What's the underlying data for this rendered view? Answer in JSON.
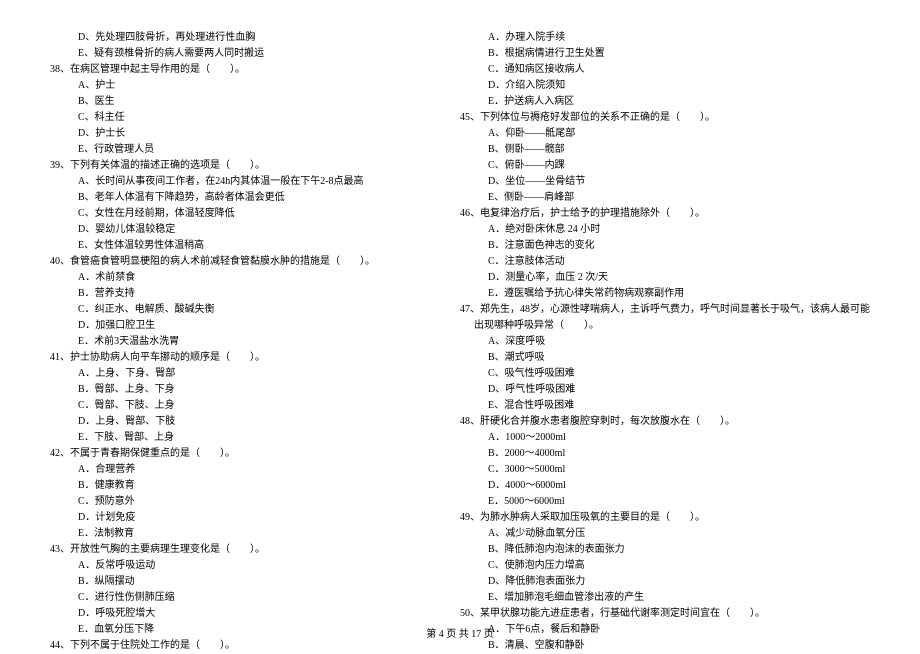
{
  "left": [
    {
      "cls": "opt",
      "t": "D、先处理四肢骨折，再处理进行性血胸"
    },
    {
      "cls": "opt",
      "t": "E、疑有颈椎骨折的病人需要两人同时搬运"
    },
    {
      "cls": "q",
      "t": "38、在病区管理中起主导作用的是（　　）。"
    },
    {
      "cls": "opt",
      "t": "A、护士"
    },
    {
      "cls": "opt",
      "t": "B、医生"
    },
    {
      "cls": "opt",
      "t": "C、科主任"
    },
    {
      "cls": "opt",
      "t": "D、护士长"
    },
    {
      "cls": "opt",
      "t": "E、行政管理人员"
    },
    {
      "cls": "q",
      "t": "39、下列有关体温的描述正确的选项是（　　）。"
    },
    {
      "cls": "opt",
      "t": "A、长时间从事夜间工作者，在24h内其体温一般在下午2-8点最高"
    },
    {
      "cls": "opt",
      "t": "B、老年人体温有下降趋势，高龄者体温会更低"
    },
    {
      "cls": "opt",
      "t": "C、女性在月经前期，体温轻度降低"
    },
    {
      "cls": "opt",
      "t": "D、婴幼儿体温较稳定"
    },
    {
      "cls": "opt",
      "t": "E、女性体温较男性体温稍高"
    },
    {
      "cls": "q",
      "t": "40、食管癌食管明显梗阻的病人术前减轻食管黏膜水肿的措施是（　　）。"
    },
    {
      "cls": "opt",
      "t": "A．术前禁食"
    },
    {
      "cls": "opt",
      "t": "B．营养支持"
    },
    {
      "cls": "opt",
      "t": "C．纠正水、电解质、酸碱失衡"
    },
    {
      "cls": "opt",
      "t": "D．加强口腔卫生"
    },
    {
      "cls": "opt",
      "t": "E．术前3天温盐水洗胃"
    },
    {
      "cls": "q",
      "t": "41、护士协助病人向平车挪动的顺序是（　　）。"
    },
    {
      "cls": "opt",
      "t": "A．上身、下身、臀部"
    },
    {
      "cls": "opt",
      "t": "B．臀部、上身、下身"
    },
    {
      "cls": "opt",
      "t": "C．臀部、下肢、上身"
    },
    {
      "cls": "opt",
      "t": "D．上身、臀部、下肢"
    },
    {
      "cls": "opt",
      "t": "E．下肢、臀部、上身"
    },
    {
      "cls": "q",
      "t": "42、不属于青春期保健重点的是（　　）。"
    },
    {
      "cls": "opt",
      "t": "A．合理营养"
    },
    {
      "cls": "opt",
      "t": "B．健康教育"
    },
    {
      "cls": "opt",
      "t": "C．预防意外"
    },
    {
      "cls": "opt",
      "t": "D．计划免疫"
    },
    {
      "cls": "opt",
      "t": "E．法制教育"
    },
    {
      "cls": "q",
      "t": "43、开放性气胸的主要病理生理变化是（　　）。"
    },
    {
      "cls": "opt",
      "t": "A．反常呼吸运动"
    },
    {
      "cls": "opt",
      "t": "B．纵隔摆动"
    },
    {
      "cls": "opt",
      "t": "C．进行性伤侧肺压缩"
    },
    {
      "cls": "opt",
      "t": "D．呼吸死腔增大"
    },
    {
      "cls": "opt",
      "t": "E．血氧分压下降"
    },
    {
      "cls": "q",
      "t": "44、下列不属于住院处工作的是（　　）。"
    }
  ],
  "right": [
    {
      "cls": "opt",
      "t": "A．办理入院手续"
    },
    {
      "cls": "opt",
      "t": "B．根据病情进行卫生处置"
    },
    {
      "cls": "opt",
      "t": "C．通知病区接收病人"
    },
    {
      "cls": "opt",
      "t": "D．介绍入院须知"
    },
    {
      "cls": "opt",
      "t": "E．护送病人入病区"
    },
    {
      "cls": "q",
      "t": "45、下列体位与褥疮好发部位的关系不正确的是（　　）。"
    },
    {
      "cls": "opt",
      "t": "A、仰卧——骶尾部"
    },
    {
      "cls": "opt",
      "t": "B、侧卧——髋部"
    },
    {
      "cls": "opt",
      "t": "C、俯卧——内踝"
    },
    {
      "cls": "opt",
      "t": "D、坐位——坐骨结节"
    },
    {
      "cls": "opt",
      "t": "E、侧卧——肩峰部"
    },
    {
      "cls": "q",
      "t": "46、电复律治疗后，护士给予的护理措施除外（　　）。"
    },
    {
      "cls": "opt",
      "t": "A．绝对卧床休息 24 小时"
    },
    {
      "cls": "opt",
      "t": "B．注意面色神志的变化"
    },
    {
      "cls": "opt",
      "t": "C．注意肢体活动"
    },
    {
      "cls": "opt",
      "t": "D．测量心率，血压 2 次/天"
    },
    {
      "cls": "opt",
      "t": "E．遵医嘱给予抗心律失常药物病观察副作用"
    },
    {
      "cls": "q",
      "t": "47、郑先生，48岁，心源性哮喘病人，主诉呼气费力，呼气时间显著长于吸气，该病人最可能"
    },
    {
      "cls": "sub",
      "t": "出现哪种呼吸异常（　　）。"
    },
    {
      "cls": "opt",
      "t": "A、深度呼吸"
    },
    {
      "cls": "opt",
      "t": "B、潮式呼吸"
    },
    {
      "cls": "opt",
      "t": "C、吸气性呼吸困难"
    },
    {
      "cls": "opt",
      "t": "D、呼气性呼吸困难"
    },
    {
      "cls": "opt",
      "t": "E、混合性呼吸困难"
    },
    {
      "cls": "q",
      "t": "48、肝硬化合并腹水患者腹腔穿刺时，每次放腹水在（　　）。"
    },
    {
      "cls": "opt",
      "t": "A．1000～2000ml"
    },
    {
      "cls": "opt",
      "t": "B．2000～4000ml"
    },
    {
      "cls": "opt",
      "t": "C．3000～5000ml"
    },
    {
      "cls": "opt",
      "t": "D．4000～6000ml"
    },
    {
      "cls": "opt",
      "t": "E．5000～6000ml"
    },
    {
      "cls": "q",
      "t": "49、为肺水肿病人采取加压吸氧的主要目的是（　　）。"
    },
    {
      "cls": "opt",
      "t": "A、减少动脉血氧分压"
    },
    {
      "cls": "opt",
      "t": "B、降低肺泡内泡沫的表面张力"
    },
    {
      "cls": "opt",
      "t": "C、使肺泡内压力增高"
    },
    {
      "cls": "opt",
      "t": "D、降低肺泡表面张力"
    },
    {
      "cls": "opt",
      "t": "E、增加肺泡毛细血管渗出液的产生"
    },
    {
      "cls": "q",
      "t": "50、某甲状腺功能亢进症患者，行基础代谢率测定时间宜在（　　）。"
    },
    {
      "cls": "opt",
      "t": "A．下午6点，餐后和静卧"
    },
    {
      "cls": "opt",
      "t": "B．清晨、空腹和静卧"
    }
  ],
  "footer": "第 4 页 共 17 页"
}
